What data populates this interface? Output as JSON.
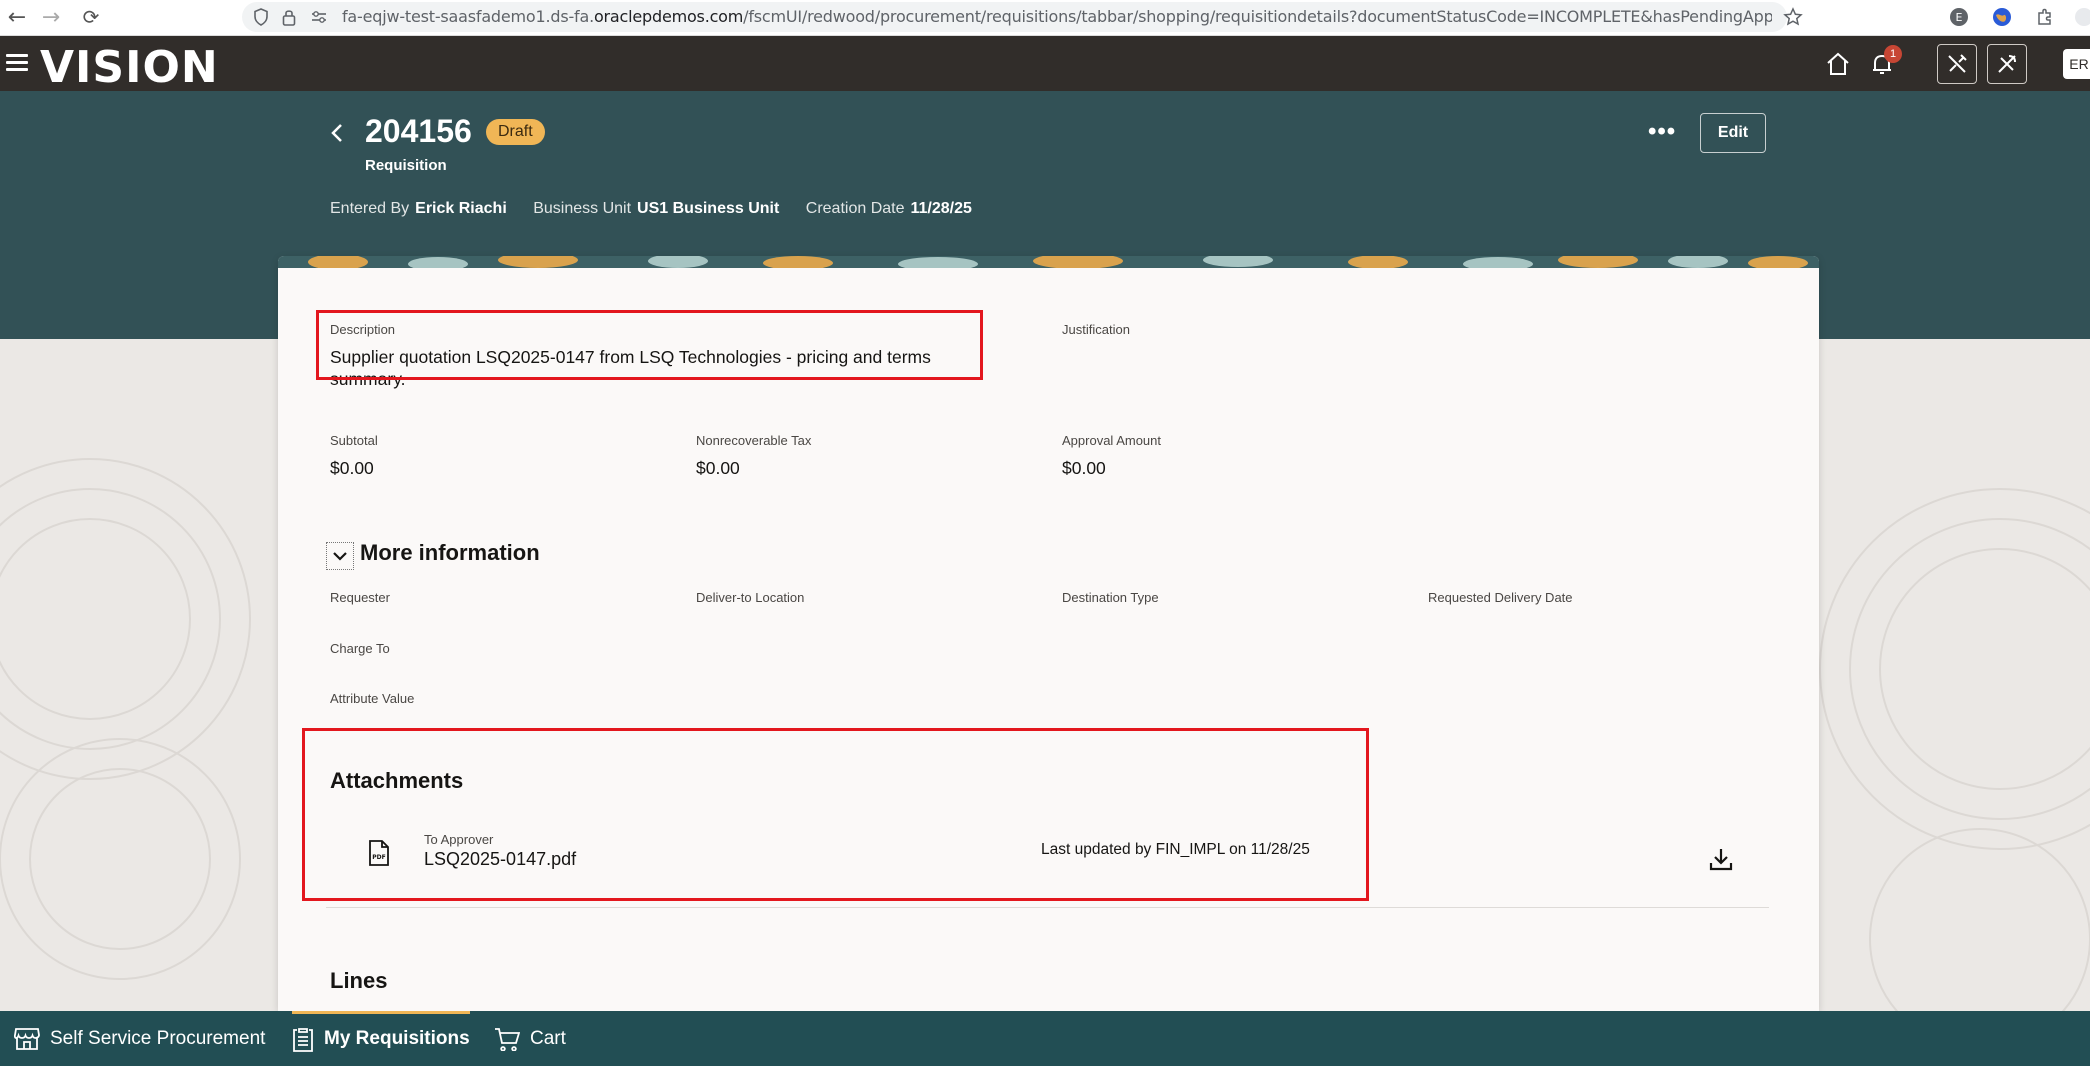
{
  "browser": {
    "url_prefix": "fa-eqjw-test-saasfademo1.ds-fa.",
    "url_domain": "oraclepdemos.com",
    "url_path": "/fscmUI/redwood/procurement/requisitions/tabbar/shopping/requisitiondetails?documentStatusCode=INCOMPLETE&hasPendingApprovalLines=null&isPreparer"
  },
  "header": {
    "logo": "VISION",
    "notification_count": "1",
    "avatar_initials": "ER"
  },
  "requisition": {
    "number": "204156",
    "status": "Draft",
    "type": "Requisition",
    "entered_by_label": "Entered By",
    "entered_by": "Erick Riachi",
    "business_unit_label": "Business Unit",
    "business_unit": "US1 Business Unit",
    "creation_date_label": "Creation Date",
    "creation_date": "11/28/25",
    "more_label": "•••",
    "edit_label": "Edit"
  },
  "summary": {
    "description_label": "Description",
    "description": "Supplier quotation LSQ2025-0147 from LSQ Technologies - pricing and terms summary.",
    "justification_label": "Justification",
    "subtotal_label": "Subtotal",
    "subtotal": "$0.00",
    "nonrecoverable_tax_label": "Nonrecoverable Tax",
    "nonrecoverable_tax": "$0.00",
    "approval_amount_label": "Approval Amount",
    "approval_amount": "$0.00"
  },
  "more_information": {
    "title": "More information",
    "requester_label": "Requester",
    "deliver_to_label": "Deliver-to Location",
    "destination_type_label": "Destination Type",
    "requested_delivery_date_label": "Requested Delivery Date",
    "charge_to_label": "Charge To",
    "attribute_value_label": "Attribute Value"
  },
  "attachments": {
    "title": "Attachments",
    "items": [
      {
        "category": "To Approver",
        "file_name": "LSQ2025-0147.pdf",
        "updated": "Last updated by FIN_IMPL on 11/28/25",
        "icon": "pdf-file-icon"
      }
    ]
  },
  "lines": {
    "title": "Lines"
  },
  "bottom_tabs": [
    {
      "label": "Self Service Procurement",
      "icon": "store-icon",
      "active": false
    },
    {
      "label": "My Requisitions",
      "icon": "clipboard-icon",
      "active": true
    },
    {
      "label": "Cart",
      "icon": "cart-icon",
      "active": false
    }
  ],
  "colors": {
    "header_bg": "#312d2a",
    "banner_bg": "#325156",
    "bottom_bar_bg": "#224e54",
    "draft_badge": "#f0b656",
    "highlight_border": "#e3171e"
  }
}
